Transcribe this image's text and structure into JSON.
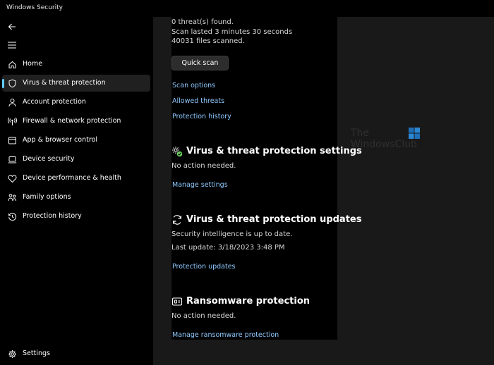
{
  "window": {
    "title": "Windows Security"
  },
  "sidebar": {
    "items": [
      {
        "label": "Home",
        "icon": "home-icon"
      },
      {
        "label": "Virus & threat protection",
        "icon": "shield-icon",
        "selected": true
      },
      {
        "label": "Account protection",
        "icon": "person-icon"
      },
      {
        "label": "Firewall & network protection",
        "icon": "wireless-icon"
      },
      {
        "label": "App & browser control",
        "icon": "browser-window-icon"
      },
      {
        "label": "Device security",
        "icon": "laptop-icon"
      },
      {
        "label": "Device performance & health",
        "icon": "heart-icon"
      },
      {
        "label": "Family options",
        "icon": "family-icon"
      },
      {
        "label": "Protection history",
        "icon": "history-icon"
      }
    ],
    "settings_label": "Settings"
  },
  "scan": {
    "threats": "0 threat(s) found.",
    "duration": "Scan lasted 3 minutes 30 seconds",
    "files": "40031 files scanned.",
    "quick_scan_label": "Quick scan",
    "links": [
      "Scan options",
      "Allowed threats",
      "Protection history"
    ]
  },
  "settings_section": {
    "title": "Virus & threat protection settings",
    "status": "No action needed.",
    "link": "Manage settings"
  },
  "updates_section": {
    "title": "Virus & threat protection updates",
    "status": "Security intelligence is up to date.",
    "last_update": "Last update: 3/18/2023 3:48 PM",
    "link": "Protection updates"
  },
  "ransomware_section": {
    "title": "Ransomware protection",
    "status": "No action needed.",
    "link": "Manage ransomware protection"
  },
  "watermark": {
    "line1": "The",
    "line2": "WindowsClub"
  },
  "colors": {
    "accent": "#60cdff",
    "link": "#8fc9ff",
    "content_bg": "#191919",
    "selected_bg": "#202020"
  }
}
